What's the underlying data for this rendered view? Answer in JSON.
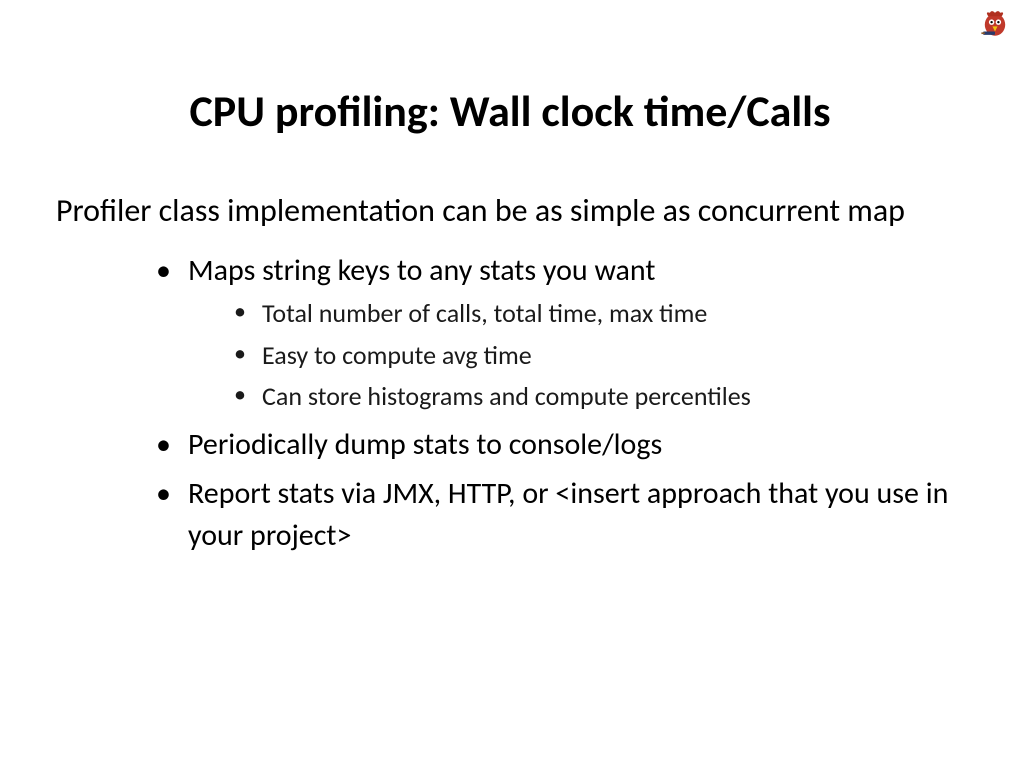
{
  "slide": {
    "title": "CPU profiling: Wall clock time/Calls",
    "intro": "Profiler class implementation can be as simple as concurrent map",
    "bullets": [
      {
        "text": "Maps string keys to any stats you want",
        "sub": [
          "Total number of calls, total time, max time",
          "Easy to compute avg time",
          "Can store histograms and compute percentiles"
        ]
      },
      {
        "text": "Periodically dump stats to console/logs",
        "sub": []
      },
      {
        "text": "Report stats via JMX, HTTP, or <insert approach that you use in your project>",
        "sub": []
      }
    ]
  }
}
